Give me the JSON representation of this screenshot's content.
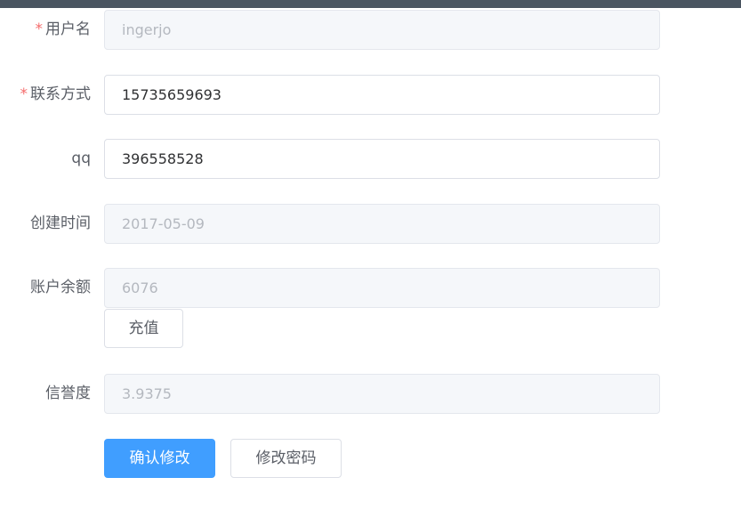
{
  "form": {
    "username": {
      "label": "用户名",
      "required": true,
      "value": "ingerjo",
      "disabled": true
    },
    "contact": {
      "label": "联系方式",
      "required": true,
      "value": "15735659693",
      "disabled": false
    },
    "qq": {
      "label": "qq",
      "required": false,
      "value": "396558528",
      "disabled": false
    },
    "created": {
      "label": "创建时间",
      "required": false,
      "value": "2017-05-09",
      "disabled": true
    },
    "balance": {
      "label": "账户余额",
      "required": false,
      "value": "6076",
      "disabled": true
    },
    "credit": {
      "label": "信誉度",
      "required": false,
      "value": "3.9375",
      "disabled": true
    }
  },
  "required_mark": "*",
  "buttons": {
    "recharge": "充值",
    "confirm": "确认修改",
    "change_password": "修改密码"
  },
  "colors": {
    "primary": "#409eff",
    "required": "#f56c6c",
    "topbar": "#4a5561"
  }
}
